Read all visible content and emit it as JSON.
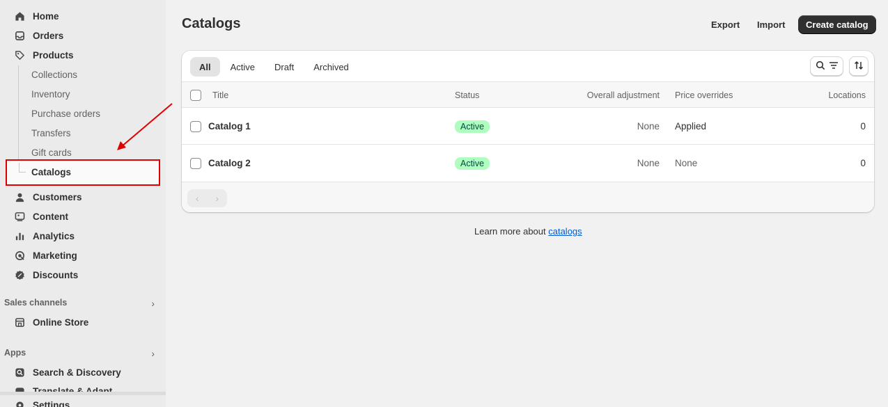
{
  "sidebar": {
    "items": [
      {
        "label": "Home",
        "icon": "home-icon"
      },
      {
        "label": "Orders",
        "icon": "inbox-icon"
      },
      {
        "label": "Products",
        "icon": "tag-icon"
      }
    ],
    "product_sub": [
      "Collections",
      "Inventory",
      "Purchase orders",
      "Transfers",
      "Gift cards"
    ],
    "active_sub": "Catalogs",
    "items2": [
      {
        "label": "Customers",
        "icon": "person-icon"
      },
      {
        "label": "Content",
        "icon": "content-icon"
      },
      {
        "label": "Analytics",
        "icon": "bar-chart-icon"
      },
      {
        "label": "Marketing",
        "icon": "target-icon"
      },
      {
        "label": "Discounts",
        "icon": "discount-icon"
      }
    ],
    "sales_channels_label": "Sales channels",
    "online_store_label": "Online Store",
    "apps_label": "Apps",
    "apps": [
      "Search & Discovery",
      "Translate & Adapt"
    ],
    "settings_label": "Settings"
  },
  "header": {
    "title": "Catalogs",
    "export_label": "Export",
    "import_label": "Import",
    "create_label": "Create catalog"
  },
  "tabs": [
    "All",
    "Active",
    "Draft",
    "Archived"
  ],
  "table": {
    "columns": [
      "Title",
      "Status",
      "Overall adjustment",
      "Price overrides",
      "Locations"
    ],
    "rows": [
      {
        "title": "Catalog 1",
        "status": "Active",
        "adjustment": "None",
        "overrides": "Applied",
        "locations": "0"
      },
      {
        "title": "Catalog 2",
        "status": "Active",
        "adjustment": "None",
        "overrides": "None",
        "locations": "0"
      }
    ]
  },
  "learn_more": {
    "prefix": "Learn more about ",
    "link": "catalogs"
  },
  "colors": {
    "annotation": "#e00000",
    "badge_bg": "#affebf",
    "link": "#005bd3"
  }
}
